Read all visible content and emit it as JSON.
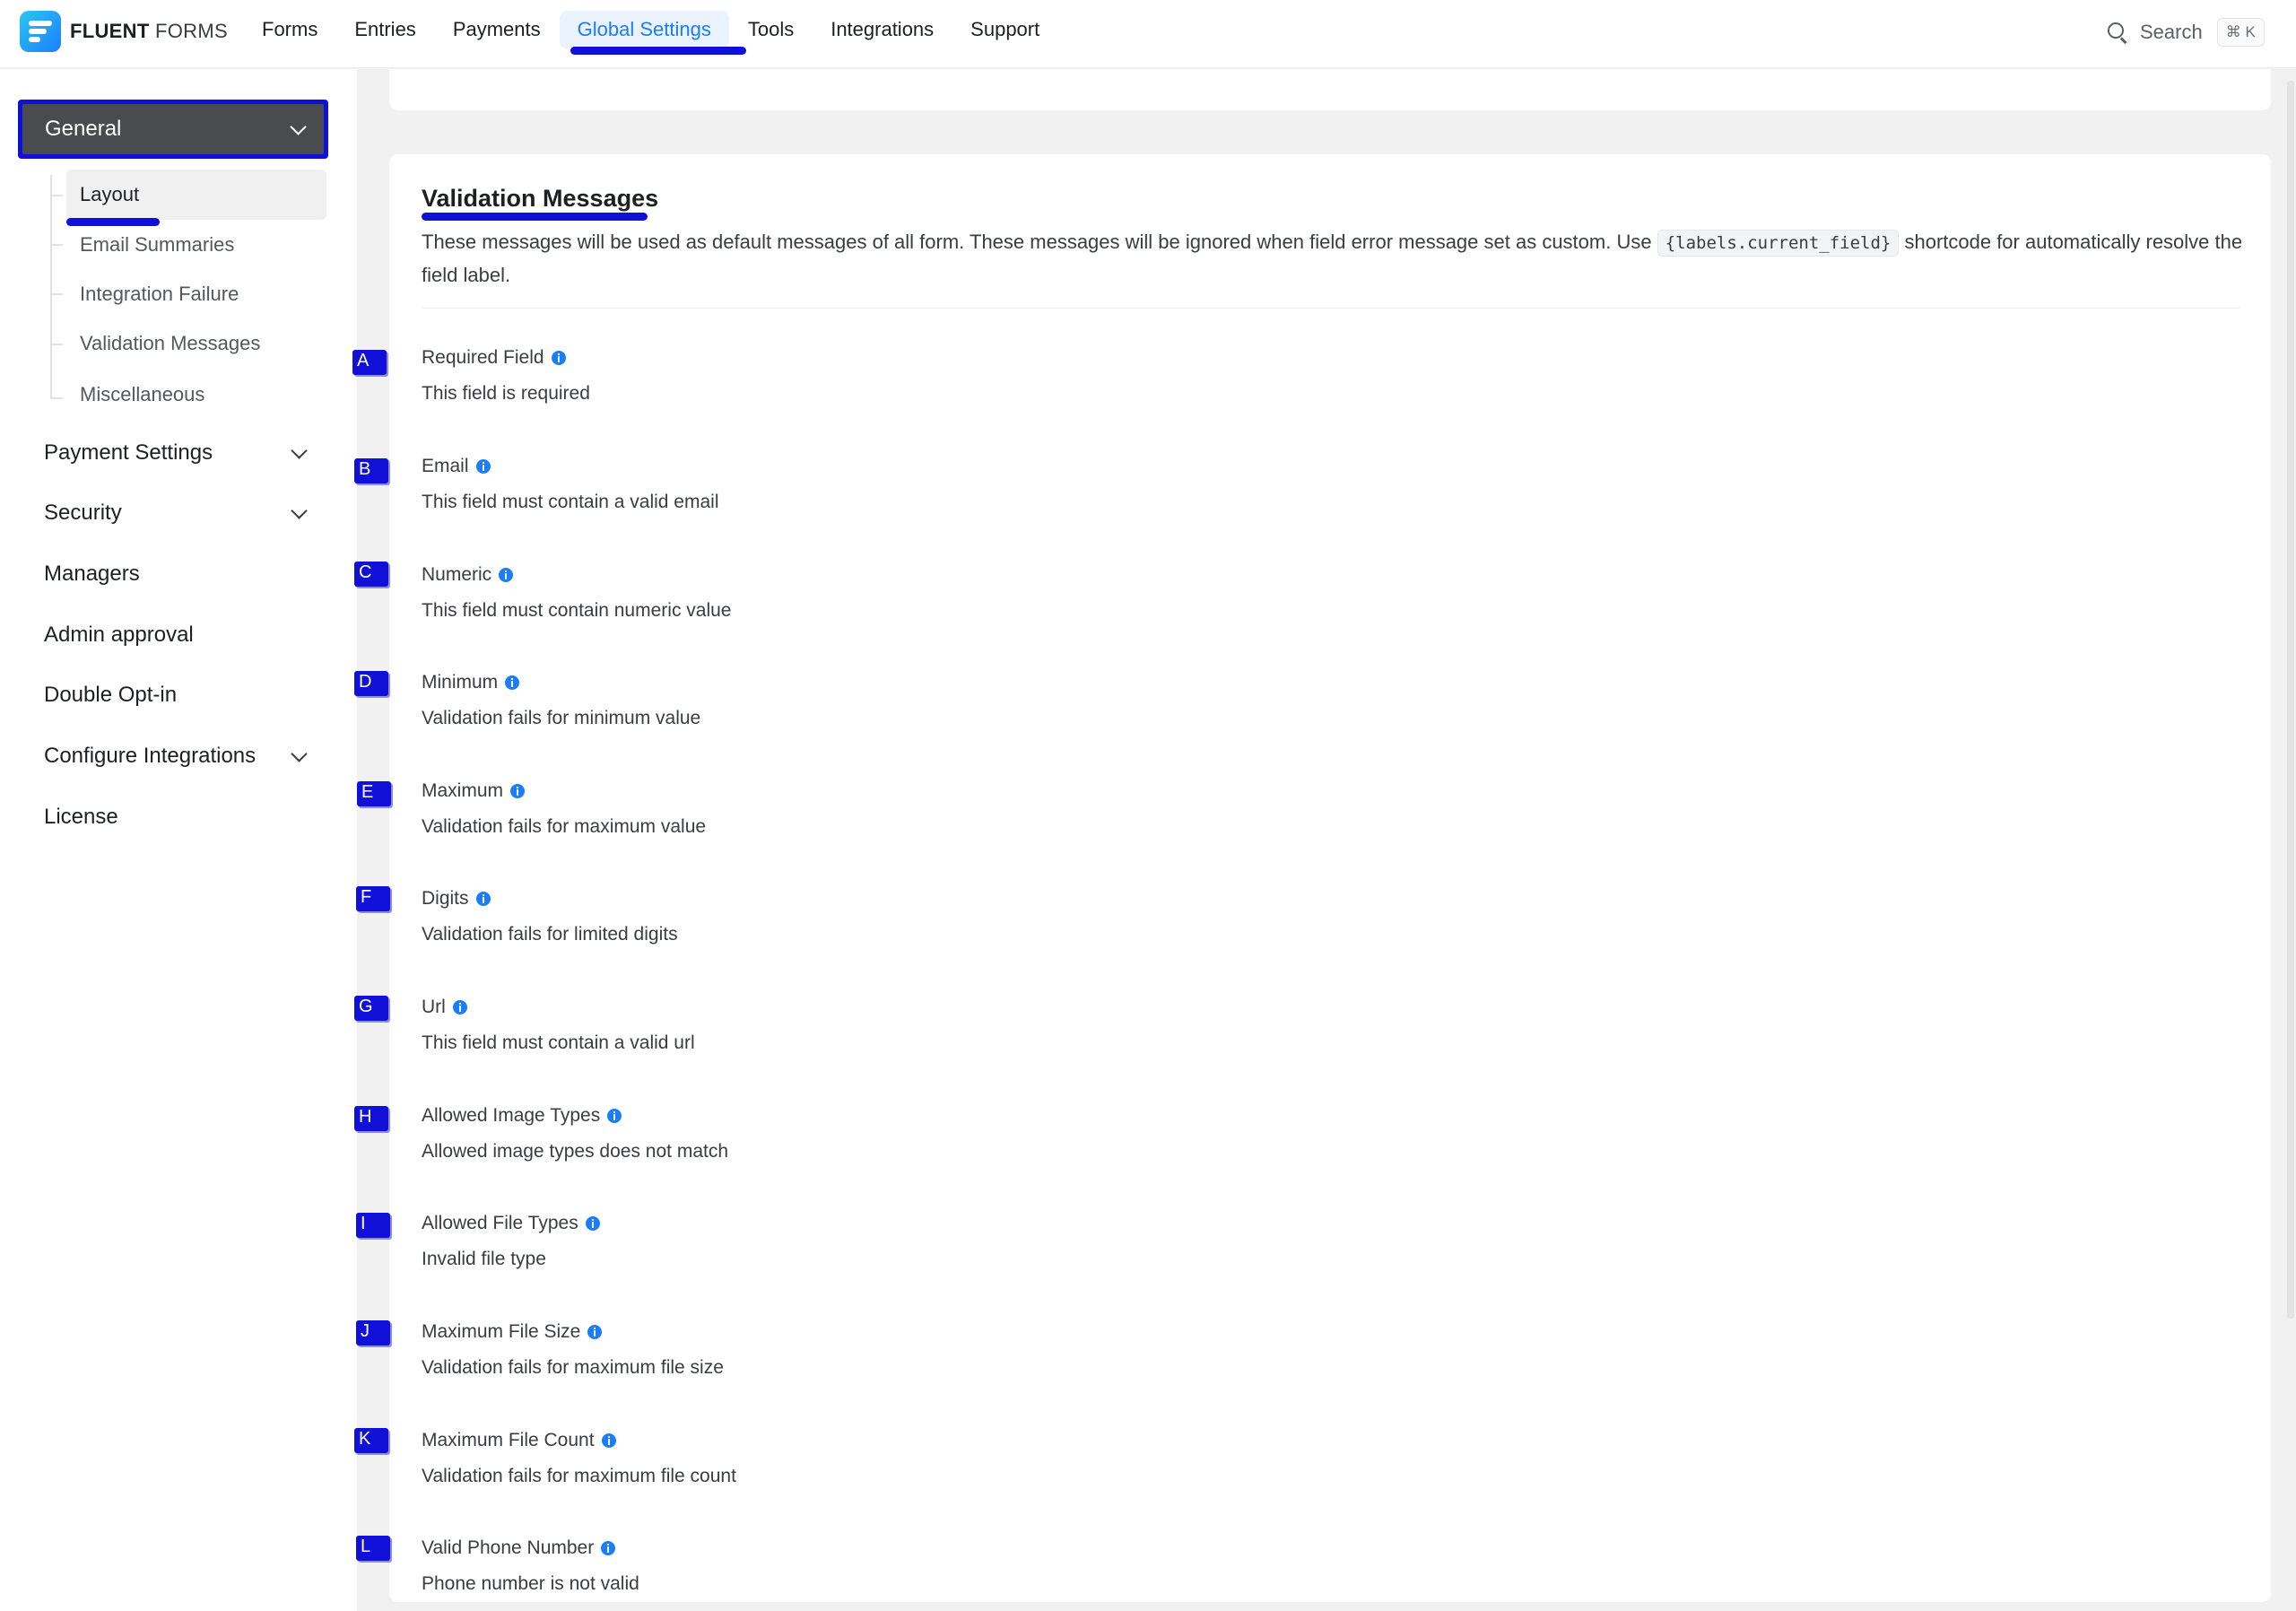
{
  "brand": {
    "name_bold": "FLUENT",
    "name_light": " FORMS"
  },
  "nav": [
    {
      "label": "Forms"
    },
    {
      "label": "Entries"
    },
    {
      "label": "Payments"
    },
    {
      "label": "Global Settings"
    },
    {
      "label": "Tools"
    },
    {
      "label": "Integrations"
    },
    {
      "label": "Support"
    }
  ],
  "search": {
    "label": "Search",
    "shortcut": "⌘ K"
  },
  "sidebar": {
    "general": {
      "label": "General"
    },
    "general_sub": [
      {
        "label": "Layout"
      },
      {
        "label": "Email Summaries"
      },
      {
        "label": "Integration Failure"
      },
      {
        "label": "Validation Messages"
      },
      {
        "label": "Miscellaneous"
      }
    ],
    "items": [
      {
        "label": "Payment Settings"
      },
      {
        "label": "Security"
      },
      {
        "label": "Managers"
      },
      {
        "label": "Admin approval"
      },
      {
        "label": "Double Opt-in"
      },
      {
        "label": "Configure Integrations"
      },
      {
        "label": "License"
      }
    ]
  },
  "main": {
    "title": "Validation Messages",
    "description_before": "These messages will be used as default messages of all form. These messages will be ignored when field error message set as custom. Use ",
    "shortcode": "{labels.current_field}",
    "description_after": " shortcode for automatically resolve the field label.",
    "fields": [
      {
        "marker": "A",
        "label": "Required Field",
        "value": "This field is required"
      },
      {
        "marker": "B",
        "label": "Email",
        "value": "This field must contain a valid email"
      },
      {
        "marker": "C",
        "label": "Numeric",
        "value": "This field must contain numeric value"
      },
      {
        "marker": "D",
        "label": "Minimum",
        "value": "Validation fails for minimum value"
      },
      {
        "marker": "E",
        "label": "Maximum",
        "value": "Validation fails for maximum value"
      },
      {
        "marker": "F",
        "label": "Digits",
        "value": "Validation fails for limited digits"
      },
      {
        "marker": "G",
        "label": "Url",
        "value": "This field must contain a valid url"
      },
      {
        "marker": "H",
        "label": "Allowed Image Types",
        "value": "Allowed image types does not match"
      },
      {
        "marker": "I",
        "label": "Allowed File Types",
        "value": "Invalid file type"
      },
      {
        "marker": "J",
        "label": "Maximum File Size",
        "value": "Validation fails for maximum file size"
      },
      {
        "marker": "K",
        "label": "Maximum File Count",
        "value": "Validation fails for maximum file count"
      },
      {
        "marker": "L",
        "label": "Valid Phone Number",
        "value": "Phone number is not valid"
      }
    ]
  },
  "colors": {
    "accent": "#1a7efb",
    "annotation": "#1010d8"
  }
}
